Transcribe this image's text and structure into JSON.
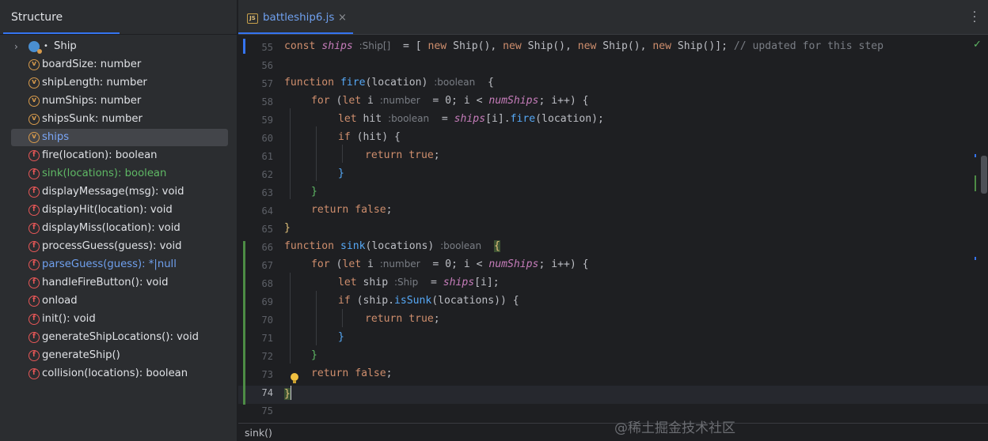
{
  "structure": {
    "title": "Structure",
    "class_name": "Ship",
    "items": [
      {
        "badge": "v",
        "label": "boardSize: number"
      },
      {
        "badge": "v",
        "label": "shipLength: number"
      },
      {
        "badge": "v",
        "label": "numShips: number"
      },
      {
        "badge": "v",
        "label": "shipsSunk: number"
      },
      {
        "badge": "v",
        "label": "ships"
      },
      {
        "badge": "f",
        "label": "fire(location): boolean"
      },
      {
        "badge": "f",
        "label": "sink(locations): boolean"
      },
      {
        "badge": "f",
        "label": "displayMessage(msg): void"
      },
      {
        "badge": "f",
        "label": "displayHit(location): void"
      },
      {
        "badge": "f",
        "label": "displayMiss(location): void"
      },
      {
        "badge": "f",
        "label": "processGuess(guess): void"
      },
      {
        "badge": "f",
        "label": "parseGuess(guess): *|null"
      },
      {
        "badge": "f",
        "label": "handleFireButton(): void"
      },
      {
        "badge": "f",
        "label": "onload"
      },
      {
        "badge": "f",
        "label": "init(): void"
      },
      {
        "badge": "f",
        "label": "generateShipLocations(): void"
      },
      {
        "badge": "f",
        "label": "generateShip()"
      },
      {
        "badge": "f",
        "label": "collision(locations): boolean"
      }
    ]
  },
  "editor": {
    "tab_label": "battleship6.js",
    "tab_icon_text": "JS",
    "tab_close": "×",
    "current_line": 74,
    "line_numbers": [
      "55",
      "56",
      "57",
      "58",
      "59",
      "60",
      "61",
      "62",
      "63",
      "64",
      "65",
      "66",
      "67",
      "68",
      "69",
      "70",
      "71",
      "72",
      "73",
      "74",
      "75"
    ],
    "code": {
      "l55": {
        "kw1": "const",
        "var": "ships",
        "hint": ":Ship[]",
        "rest1": "  = [ ",
        "kw2": "new",
        "t1": " Ship(), ",
        "kw3": "new",
        "t2": " Ship(), ",
        "kw4": "new",
        "t3": " Ship(), ",
        "kw5": "new",
        "t4": " Ship()]; ",
        "comment": "// updated for this step"
      },
      "l57": {
        "kw": "function",
        "fn": "fire",
        "args": "(location)",
        "hint": ":boolean",
        "brace": "  {"
      },
      "l58": {
        "kw1": "for",
        "t1": " (",
        "kw2": "let",
        "t2": " i ",
        "hint": ":number",
        "t3": "  = 0; i < ",
        "gl": "numShips",
        "t4": "; i++) {"
      },
      "l59": {
        "kw": "let",
        "t1": " hit ",
        "hint": ":boolean",
        "t2": "  = ",
        "gl": "ships",
        "t3": "[i].",
        "fn": "fire",
        "t4": "(location);"
      },
      "l60": {
        "kw": "if",
        "t": " (hit) {"
      },
      "l61": {
        "kw1": "return",
        "kw2": " true",
        "t": ";"
      },
      "l62": {
        "t": "}"
      },
      "l63": {
        "t": "}"
      },
      "l64": {
        "kw1": "return",
        "kw2": " false",
        "t": ";"
      },
      "l65": {
        "t": "}"
      },
      "l66": {
        "kw": "function",
        "fn": "sink",
        "args": "(locations)",
        "hint": ":boolean",
        "brace": "{"
      },
      "l67": {
        "kw1": "for",
        "t1": " (",
        "kw2": "let",
        "t2": " i ",
        "hint": ":number",
        "t3": "  = 0; i < ",
        "gl": "numShips",
        "t4": "; i++) {"
      },
      "l68": {
        "kw": "let",
        "t1": " ship ",
        "hint": ":Ship",
        "t2": "  = ",
        "gl": "ships",
        "t3": "[i];"
      },
      "l69": {
        "kw": "if",
        "t1": " (ship.",
        "fn": "isSunk",
        "t2": "(locations)) {"
      },
      "l70": {
        "kw1": "return",
        "kw2": " true",
        "t": ";"
      },
      "l71": {
        "t": "}"
      },
      "l72": {
        "t": "}"
      },
      "l73": {
        "kw1": "return",
        "kw2": " false",
        "t": ";"
      },
      "l74": {
        "t": "}"
      }
    }
  },
  "breadcrumb": "sink()",
  "watermark": "@稀土掘金技术社区",
  "colors": {
    "accent": "#3574f0",
    "keyword": "#cf8e6d",
    "function": "#56a8f5",
    "global": "#c77dbb"
  }
}
